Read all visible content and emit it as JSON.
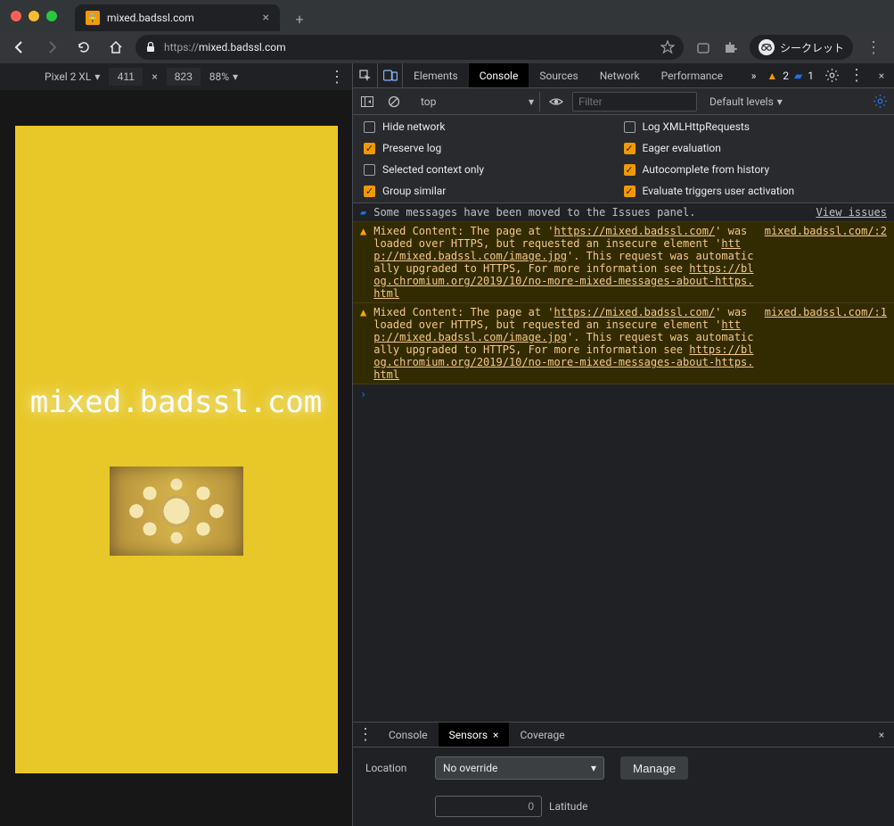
{
  "window": {
    "tab_title": "mixed.badssl.com",
    "url_proto": "https://",
    "url_rest": "mixed.badssl.com",
    "incognito_label": "シークレット"
  },
  "device_toolbar": {
    "device": "Pixel 2 XL",
    "width": "411",
    "height": "823",
    "zoom": "88%"
  },
  "viewport": {
    "title": "mixed.badssl.com"
  },
  "devtools_tabs": {
    "elements": "Elements",
    "console": "Console",
    "sources": "Sources",
    "network": "Network",
    "performance": "Performance"
  },
  "badges": {
    "warnings": "2",
    "info": "1"
  },
  "console_toolbar": {
    "context": "top",
    "filter_placeholder": "Filter",
    "levels": "Default levels"
  },
  "console_options": {
    "hide_network": "Hide network",
    "preserve_log": "Preserve log",
    "selected_context": "Selected context only",
    "group_similar": "Group similar",
    "log_xhr": "Log XMLHttpRequests",
    "eager_eval": "Eager evaluation",
    "autocomplete": "Autocomplete from history",
    "evaluate_triggers": "Evaluate triggers user activation"
  },
  "console_messages": {
    "info_text": "Some messages have been moved to the Issues panel.",
    "info_link": "View issues",
    "warn1_src": "mixed.badssl.com/:2",
    "warn2_src": "mixed.badssl.com/:1",
    "mixed_prefix": "Mixed Content: The page at '",
    "page_url": "https://mixed.badssl.com/",
    "mixed_mid1": "' was loaded over HTTPS, but requested an insecure element '",
    "element_url": "http://mixed.badssl.com/image.jpg",
    "mixed_mid2": "'. This request was automatically upgraded to HTTPS, For more information see ",
    "chromium_url": "https://blog.chromium.org/2019/10/no-more-mixed-messages-about-https.html"
  },
  "drawer": {
    "tab_console": "Console",
    "tab_sensors": "Sensors",
    "tab_coverage": "Coverage",
    "location_label": "Location",
    "location_value": "No override",
    "manage": "Manage",
    "lat_value": "0",
    "lat_label": "Latitude"
  }
}
